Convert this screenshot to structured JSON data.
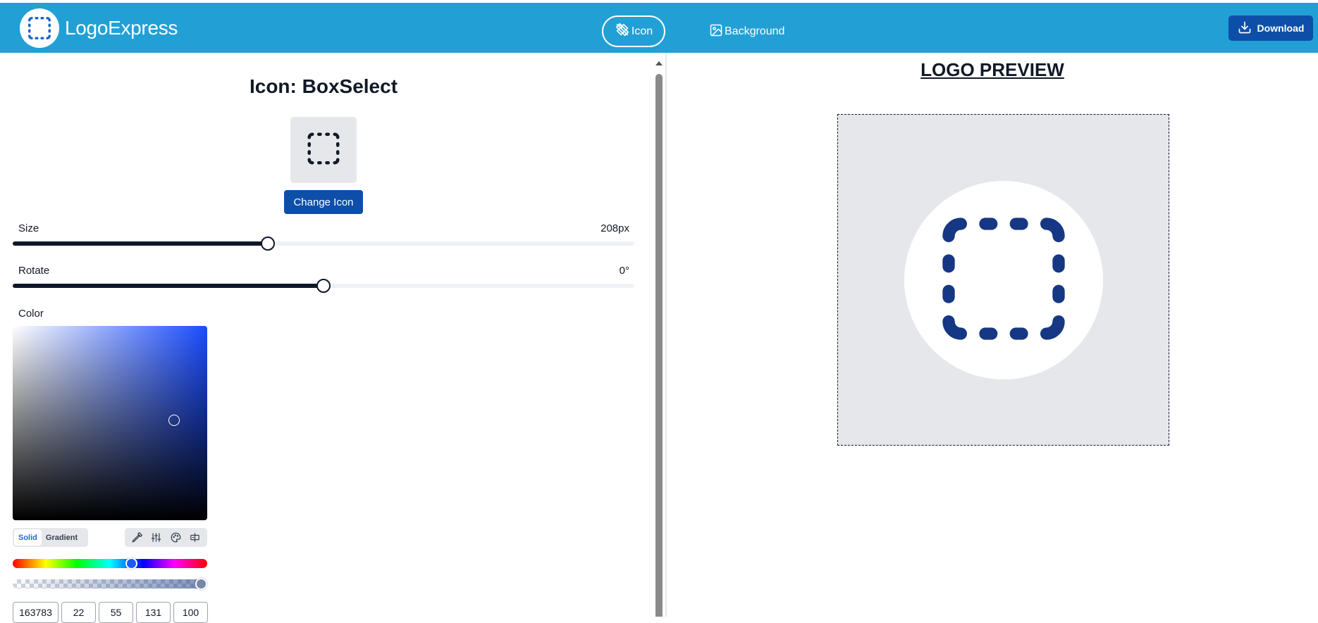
{
  "app": {
    "name": "LogoExpress"
  },
  "header": {
    "tabs": [
      {
        "label": "Icon",
        "icon": "icon-tab-icon",
        "active": true
      },
      {
        "label": "Background",
        "icon": "image-icon",
        "active": false
      }
    ],
    "download_label": "Download"
  },
  "icon_panel": {
    "title": "Icon: BoxSelect",
    "change_button": "Change Icon",
    "size": {
      "label": "Size",
      "value": "208px",
      "fraction": 0.41
    },
    "rotate": {
      "label": "Rotate",
      "value": "0°",
      "fraction": 0.5
    },
    "color": {
      "label": "Color",
      "modes": [
        "Solid",
        "Gradient"
      ],
      "active_mode": "Solid",
      "hex": "163783",
      "r": "22",
      "g": "55",
      "b": "131",
      "a": "100",
      "value_color": "#163783"
    }
  },
  "preview": {
    "title": "LOGO PREVIEW",
    "background_color": "#e5e7eb",
    "circle_color": "#ffffff",
    "icon_color": "#163783"
  }
}
